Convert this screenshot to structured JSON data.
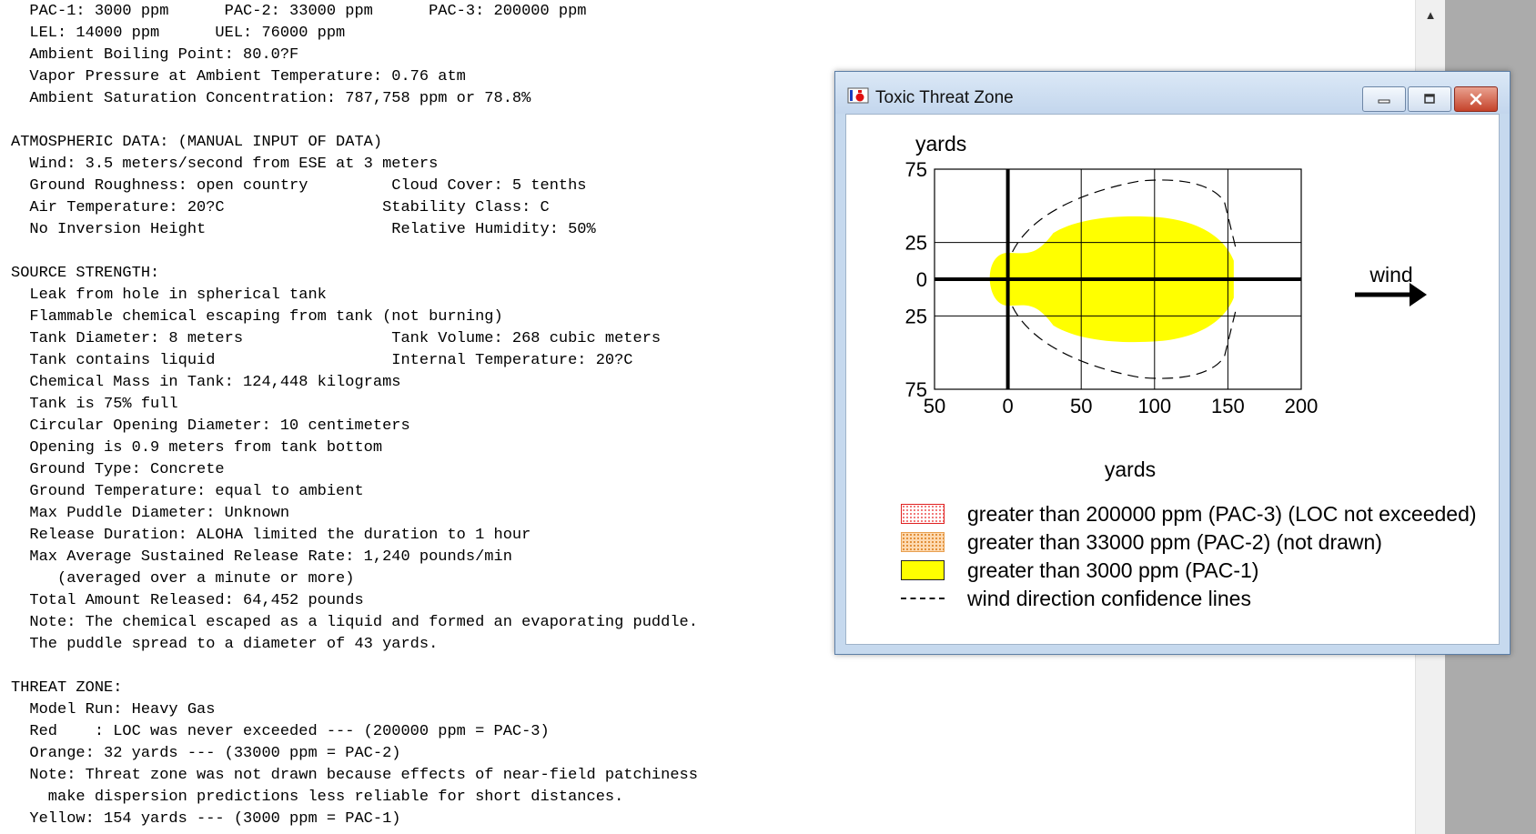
{
  "report": {
    "lines": [
      "  PAC-1: 3000 ppm      PAC-2: 33000 ppm      PAC-3: 200000 ppm",
      "  LEL: 14000 ppm      UEL: 76000 ppm",
      "  Ambient Boiling Point: 80.0?F",
      "  Vapor Pressure at Ambient Temperature: 0.76 atm",
      "  Ambient Saturation Concentration: 787,758 ppm or 78.8%",
      "",
      "ATMOSPHERIC DATA: (MANUAL INPUT OF DATA)",
      "  Wind: 3.5 meters/second from ESE at 3 meters",
      "  Ground Roughness: open country         Cloud Cover: 5 tenths",
      "  Air Temperature: 20?C                 Stability Class: C",
      "  No Inversion Height                    Relative Humidity: 50%",
      "",
      "SOURCE STRENGTH:",
      "  Leak from hole in spherical tank",
      "  Flammable chemical escaping from tank (not burning)",
      "  Tank Diameter: 8 meters                Tank Volume: 268 cubic meters",
      "  Tank contains liquid                   Internal Temperature: 20?C",
      "  Chemical Mass in Tank: 124,448 kilograms",
      "  Tank is 75% full",
      "  Circular Opening Diameter: 10 centimeters",
      "  Opening is 0.9 meters from tank bottom",
      "  Ground Type: Concrete",
      "  Ground Temperature: equal to ambient",
      "  Max Puddle Diameter: Unknown",
      "  Release Duration: ALOHA limited the duration to 1 hour",
      "  Max Average Sustained Release Rate: 1,240 pounds/min",
      "     (averaged over a minute or more)",
      "  Total Amount Released: 64,452 pounds",
      "  Note: The chemical escaped as a liquid and formed an evaporating puddle.",
      "  The puddle spread to a diameter of 43 yards.",
      "",
      "THREAT ZONE:",
      "  Model Run: Heavy Gas",
      "  Red    : LOC was never exceeded --- (200000 ppm = PAC-3)",
      "  Orange: 32 yards --- (33000 ppm = PAC-2)",
      "  Note: Threat zone was not drawn because effects of near-field patchiness",
      "    make dispersion predictions less reliable for short distances.",
      "  Yellow: 154 yards --- (3000 ppm = PAC-1)"
    ]
  },
  "window": {
    "title": "Toxic Threat Zone",
    "icon": "aloha-app-icon",
    "buttons": [
      "minimize-icon",
      "maximize-icon",
      "close-icon"
    ]
  },
  "plot": {
    "y_unit_label": "yards",
    "x_unit_label": "yards",
    "wind_label": "wind",
    "x_ticks": [
      {
        "value": -50,
        "label": "50"
      },
      {
        "value": 0,
        "label": "0"
      },
      {
        "value": 50,
        "label": "50"
      },
      {
        "value": 100,
        "label": "100"
      },
      {
        "value": 150,
        "label": "150"
      },
      {
        "value": 200,
        "label": "200"
      }
    ],
    "y_ticks": [
      {
        "value": 75,
        "label": "75"
      },
      {
        "value": 25,
        "label": "25"
      },
      {
        "value": 0,
        "label": "0"
      },
      {
        "value": -25,
        "label": "25"
      },
      {
        "value": -75,
        "label": "75"
      }
    ],
    "x_range": [
      -50,
      200
    ],
    "y_range": [
      -75,
      75
    ],
    "pac1_zone_max_x": 154,
    "pac1_zone_half_width": 42,
    "colors": {
      "pac1": "#ffff00",
      "pac2": "#fdd9b0",
      "pac3": "#e02020"
    }
  },
  "legend": [
    {
      "label": "greater than 200000 ppm (PAC-3) (LOC not exceeded)"
    },
    {
      "label": "greater than 33000 ppm (PAC-2) (not drawn)"
    },
    {
      "label": "greater than 3000 ppm (PAC-1)"
    },
    {
      "label": "wind direction confidence lines"
    }
  ]
}
